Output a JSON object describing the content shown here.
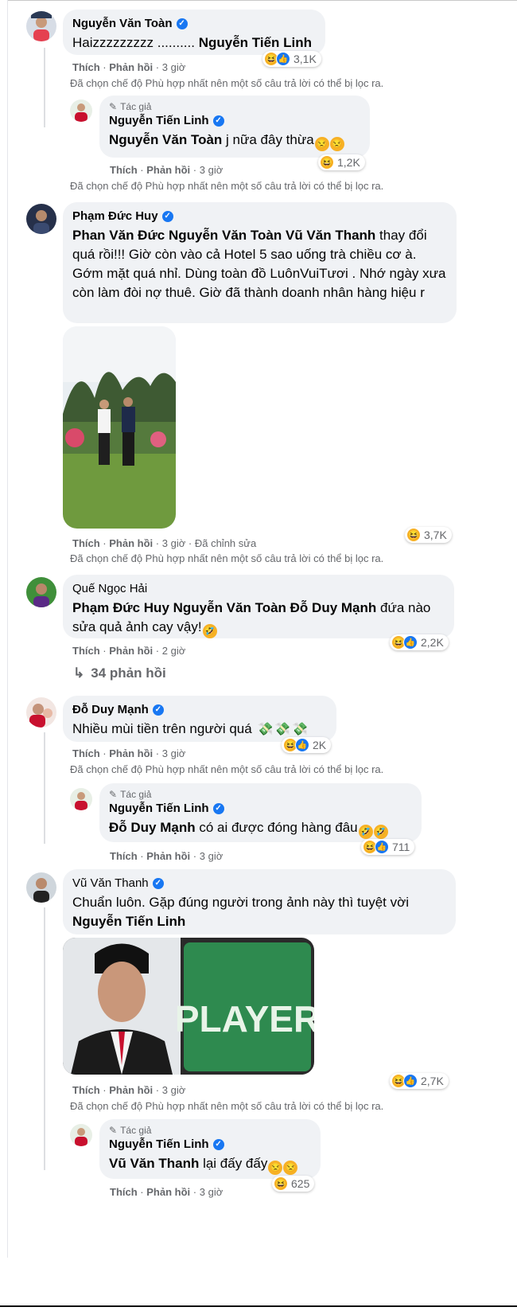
{
  "common": {
    "like": "Thích",
    "reply": "Phản hồi",
    "sep": "·",
    "filter_note": "Đã chọn chế độ Phù hợp nhất nên một số câu trả lời có thể bị lọc ra.",
    "author": "Tác giả"
  },
  "comments": [
    {
      "name": "Nguyễn Văn Toàn",
      "text": "Haizzzzzzzzz ..........",
      "mention": "Nguyễn Tiến Linh",
      "time": "3 giờ",
      "reaction_count": "3,1K",
      "reply": {
        "name": "Nguyễn Tiến Linh",
        "mention": "Nguyễn Văn Toàn",
        "text": " j nữa đây thừa",
        "time": "3 giờ",
        "reaction_count": "1,2K"
      }
    },
    {
      "name": "Phạm Đức Huy",
      "mentions": "Phan Văn Đức Nguyễn Văn Toàn Vũ Văn Thanh",
      "text": " thay đổi quá rồi!!! Giờ còn vào cả Hotel 5 sao uống trà chiều cơ à. Gớm mặt quá nhỉ. Dùng toàn đồ LuônVuiTươi . Nhớ ngày xưa còn làm đòi nợ thuê. Giờ đã thành doanh nhân hàng hiệu r",
      "time": "3 giờ",
      "edited": "Đã chỉnh sửa",
      "reaction_count": "3,7K"
    },
    {
      "name": "Quế Ngọc Hải",
      "mentions": "Phạm Đức Huy Nguyễn Văn Toàn Đỗ Duy Mạnh",
      "text": " đứa nào sửa quả ảnh cay vậy!",
      "time": "2 giờ",
      "reaction_count": "2,2K",
      "replies_link": "34 phản hồi"
    },
    {
      "name": "Đỗ Duy Mạnh",
      "text": "Nhiều mùi tiền trên người quá",
      "time": "3 giờ",
      "reaction_count": "2K",
      "reply": {
        "name": "Nguyễn Tiến Linh",
        "mention": "Đỗ Duy Mạnh",
        "text": " có ai được đóng hàng đâu",
        "time": "3 giờ",
        "reaction_count": "711"
      }
    },
    {
      "name": "Vũ Văn Thanh",
      "text": "Chuẩn luôn. Gặp đúng người trong ảnh này thì tuyệt vời",
      "mention": "Nguyễn Tiến Linh",
      "photo_text": "PLAYER",
      "time": "3 giờ",
      "reaction_count": "2,7K",
      "reply": {
        "name": "Nguyễn Tiến Linh",
        "mention": "Vũ Văn Thanh",
        "text": " lại đấy đấy",
        "time": "3 giờ",
        "reaction_count": "625"
      }
    }
  ],
  "colors": {
    "bubble": "#f0f2f5",
    "verified": "#1877f2",
    "meta": "#65676b",
    "haha": "#f7b125"
  },
  "icons": {
    "verified": "verified-badge-icon",
    "author": "pencil-icon",
    "haha": "haha-reaction-icon",
    "like": "like-reaction-icon",
    "replies": "reply-arrow-icon"
  }
}
